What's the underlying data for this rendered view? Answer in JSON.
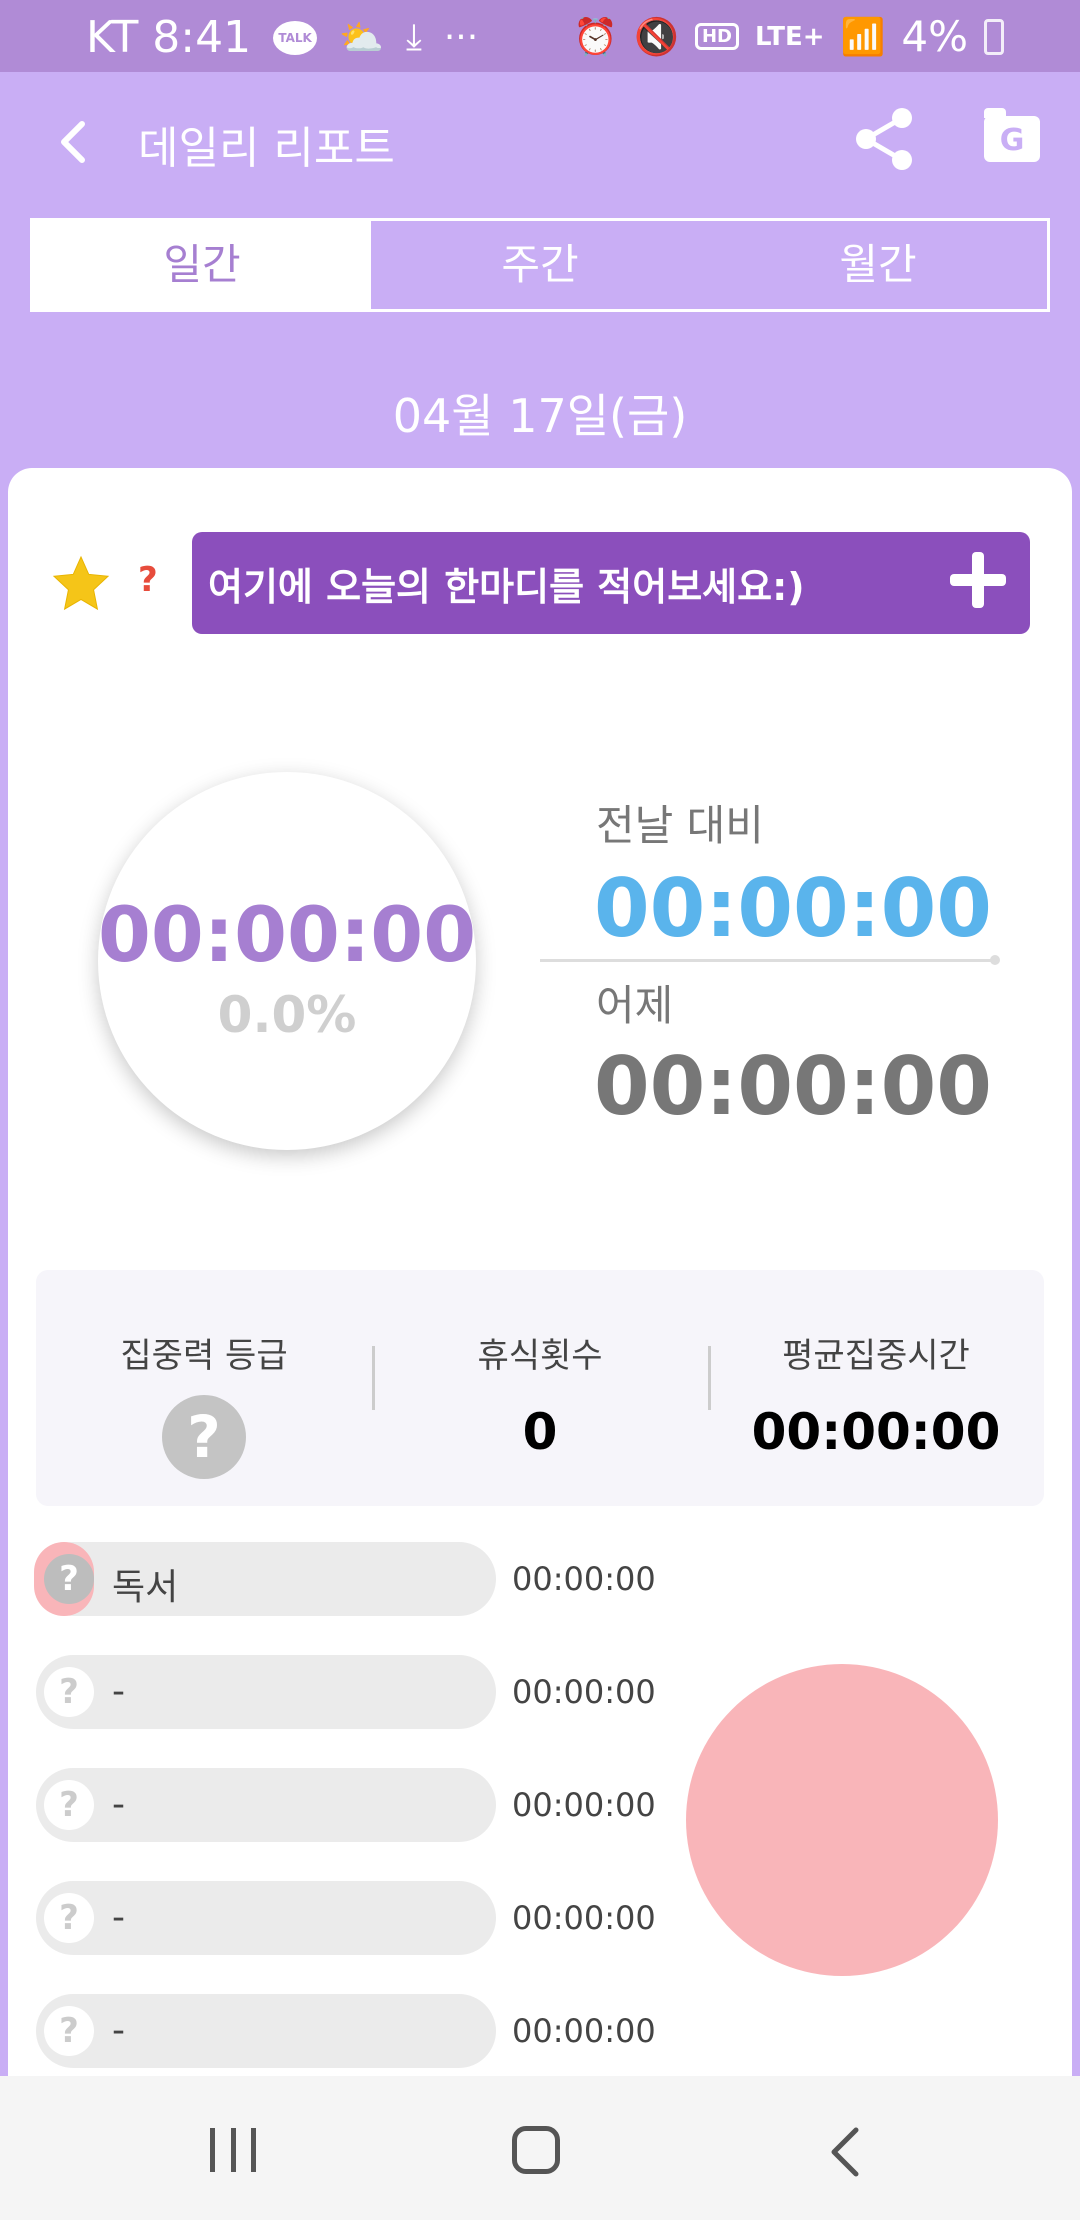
{
  "status_bar": {
    "carrier_time": "KT 8:41",
    "talk_badge": "TALK",
    "more": "···",
    "hd": "HD",
    "network": "LTE+",
    "battery": "4%"
  },
  "header": {
    "title": "데일리 리포트",
    "drive_badge": "G"
  },
  "tabs": [
    {
      "label": "일간",
      "active": true
    },
    {
      "label": "주간",
      "active": false
    },
    {
      "label": "월간",
      "active": false
    }
  ],
  "date": "04월 17일(금)",
  "memo": {
    "help": "?",
    "placeholder": "여기에 오늘의 한마디를 적어보세요:)"
  },
  "today": {
    "time": "00:00:00",
    "percent": "0.0%"
  },
  "compare": {
    "diff_label": "전날 대비",
    "diff_time": "00:00:00",
    "yesterday_label": "어제",
    "yesterday_time": "00:00:00"
  },
  "stats": {
    "grade_label": "집중력 등급",
    "grade_value": "?",
    "breaks_label": "휴식횟수",
    "breaks_value": "0",
    "avg_label": "평균집중시간",
    "avg_value": "00:00:00"
  },
  "subjects": [
    {
      "icon": "?",
      "name": "독서",
      "time": "00:00:00"
    },
    {
      "icon": "?",
      "name": "-",
      "time": "00:00:00"
    },
    {
      "icon": "?",
      "name": "-",
      "time": "00:00:00"
    },
    {
      "icon": "?",
      "name": "-",
      "time": "00:00:00"
    },
    {
      "icon": "?",
      "name": "-",
      "time": "00:00:00"
    }
  ],
  "colors": {
    "brand_purple": "#c9aef5",
    "memo_purple": "#8b4fbc",
    "accent_blue": "#5ab4ec",
    "pie_pink": "#f9b5b9"
  }
}
